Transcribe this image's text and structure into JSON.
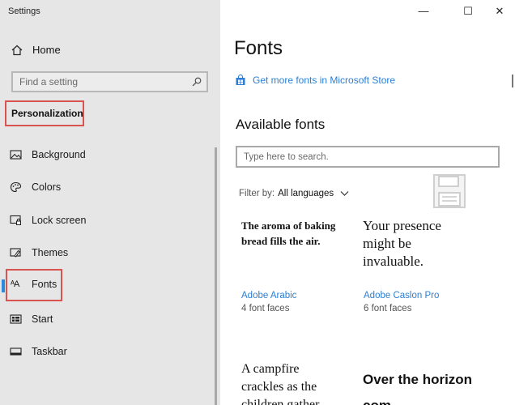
{
  "app_title": "Settings",
  "sidebar": {
    "home_label": "Home",
    "search_placeholder": "Find a setting",
    "section_label": "Personalization",
    "items": [
      {
        "label": "Background",
        "icon": "picture-icon"
      },
      {
        "label": "Colors",
        "icon": "palette-icon"
      },
      {
        "label": "Lock screen",
        "icon": "lock-screen-icon"
      },
      {
        "label": "Themes",
        "icon": "themes-icon"
      },
      {
        "label": "Fonts",
        "icon": "fonts-icon",
        "selected": true
      },
      {
        "label": "Start",
        "icon": "start-icon"
      },
      {
        "label": "Taskbar",
        "icon": "taskbar-icon"
      }
    ]
  },
  "window_controls": {
    "minimize": "—",
    "maximize": "☐",
    "close": "✕"
  },
  "main": {
    "title": "Fonts",
    "store_link": "Get more fonts in Microsoft Store",
    "available_title": "Available fonts",
    "search_placeholder": "Type here to search.",
    "filter_label": "Filter by:",
    "filter_value": "All languages",
    "fonts": [
      {
        "preview": "The aroma of baking bread fills the air.",
        "name": "Adobe Arabic",
        "faces": "4 font faces"
      },
      {
        "preview": "Your presence might be invaluable.",
        "name": "Adobe Caslon Pro",
        "faces": "6 font faces"
      },
      {
        "preview": "A campfire crackles as the children gather",
        "name": "",
        "faces": ""
      },
      {
        "preview": "Over the horizon com...",
        "name": "",
        "faces": ""
      }
    ]
  },
  "colors": {
    "accent": "#2b7fd4",
    "highlight_box": "#d9534f",
    "sidebar_bg": "#e6e6e6"
  }
}
